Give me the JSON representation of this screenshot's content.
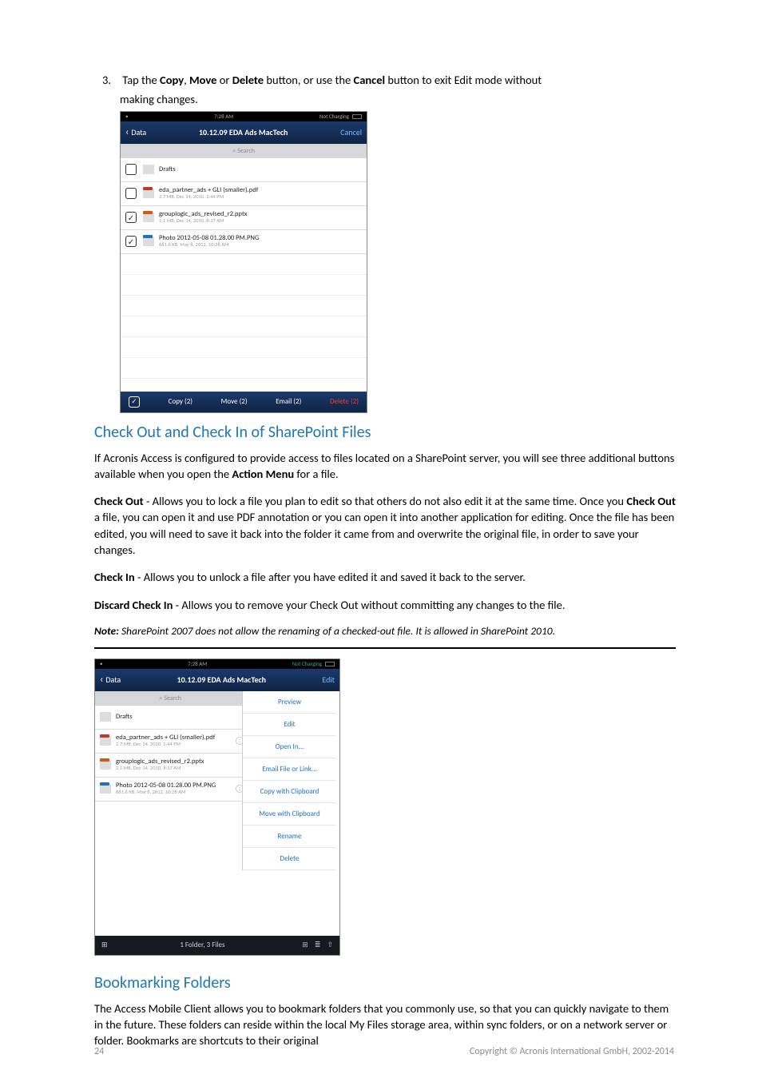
{
  "step": {
    "num": "3.",
    "before_copy": "Tap the ",
    "copy": "Copy",
    "comma1": ", ",
    "move": "Move",
    "or": " or ",
    "delete": "Delete",
    "mid": " button, or use the ",
    "cancel": "Cancel",
    "after": " button to exit Edit mode without",
    "line2": "making changes."
  },
  "shot1": {
    "status": {
      "time": "7:28 AM",
      "charge_label": "Not Charging"
    },
    "nav": {
      "back": "Data",
      "title": "10.12.09 EDA Ads MacTech",
      "cancel": "Cancel"
    },
    "search_placeholder": "Search",
    "rows": [
      {
        "check": false,
        "type": "folder",
        "t1": "Drafts",
        "t2": ""
      },
      {
        "check": false,
        "type": "pdf",
        "t1": "eda_partner_ads + GLI  (smaller).pdf",
        "t2": "2.7 MB, Dec 14, 2010, 2:44 PM"
      },
      {
        "check": true,
        "type": "pptx",
        "t1": "grouplogic_ads_revised_r2.pptx",
        "t2": "2.1 MB, Dec 14, 2010, 8:17 AM"
      },
      {
        "check": true,
        "type": "png",
        "t1": "Photo 2012-05-08 01.28.00 PM.PNG",
        "t2": "681.6 KB, May 8, 2012, 10:28 AM"
      }
    ],
    "bottom": {
      "copy": "Copy (2)",
      "move": "Move (2)",
      "email": "Email (2)",
      "delete": "Delete (2)"
    }
  },
  "h2a": "Check Out and Check In of SharePoint Files",
  "p1": {
    "t": "If Acronis Access is configured to provide access to files located on a SharePoint server, you will see three additional buttons available when you open the ",
    "b": "Action Menu",
    "t2": " for a file."
  },
  "p2": {
    "b1": "Check Out",
    "t1": " - Allows you to lock a file you plan to edit so that others do not also edit it at the same time. Once you ",
    "b2": "Check Out",
    "t2": " a file, you can open it and use PDF annotation or you can open it into another application for editing. Once the file has been edited, you will need to save it back into the folder it came from and overwrite the original file, in order to save your changes."
  },
  "p3": {
    "b": "Check In",
    "t": " - Allows you to unlock a file after you have edited it and saved it back to the server."
  },
  "p4": {
    "b": "Discard Check In",
    "t": " - Allows you to remove your Check Out without committing any changes to the file."
  },
  "note": {
    "label": "Note:",
    "t": " SharePoint 2007 does not allow the renaming of a checked-out file. It is allowed in SharePoint 2010."
  },
  "shot2": {
    "status": {
      "time": "7:28 AM",
      "charge_label": "Not Charging"
    },
    "nav": {
      "back": "Data",
      "title": "10.12.09 EDA Ads MacTech",
      "edit": "Edit"
    },
    "search_placeholder": "Search",
    "rows": [
      {
        "type": "folder",
        "t1": "Drafts",
        "t2": ""
      },
      {
        "type": "pdf",
        "t1": "eda_partner_ads + GLI  (smaller).pdf",
        "t2": "2.7 MB, Dec 14, 2010, 2:44 PM"
      },
      {
        "type": "pptx",
        "t1": "grouplogic_ads_revised_r2.pptx",
        "t2": "2.1 MB, Dec 14, 2010, 8:17 AM"
      },
      {
        "type": "png",
        "t1": "Photo 2012-05-08 01.28.00 PM.PNG",
        "t2": "681.6 KB, May 8, 2012, 10:28 AM"
      }
    ],
    "menu": [
      "Preview",
      "Edit",
      "Open In...",
      "Email File or Link...",
      "Copy with Clipboard",
      "Move with Clipboard",
      "Rename",
      "Delete"
    ],
    "footer_center": "1 Folder, 3 Files",
    "footer_icons": {
      "home": "⊞",
      "list": "≣",
      "share": "⇧"
    }
  },
  "h2b": "Bookmarking Folders",
  "p5": "The Access Mobile Client allows you to bookmark folders that you commonly use, so that you can quickly navigate to them in the future. These folders can reside within the local My Files storage area, within sync folders, or on a network server or folder. Bookmarks are shortcuts to their original",
  "footer": {
    "page": "24",
    "copyright": "Copyright © Acronis International GmbH, 2002-2014"
  }
}
